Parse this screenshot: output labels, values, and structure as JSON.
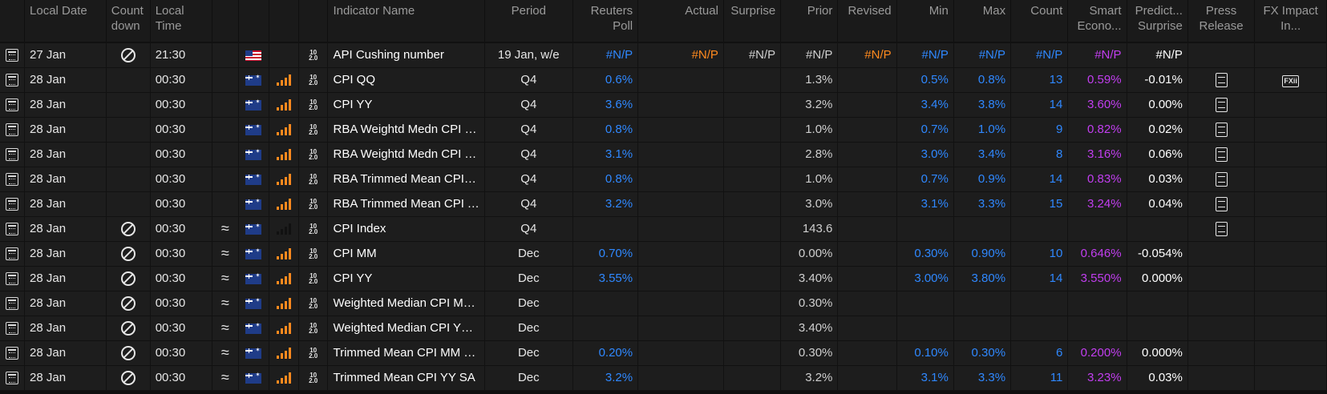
{
  "columns": [
    {
      "key": "icon",
      "label": "",
      "align": "c"
    },
    {
      "key": "date",
      "label": "Local Date",
      "align": "l"
    },
    {
      "key": "countdown",
      "label": "Count down",
      "align": "l"
    },
    {
      "key": "time",
      "label": "Local Time",
      "align": "l"
    },
    {
      "key": "approx",
      "label": "",
      "align": "c"
    },
    {
      "key": "flag",
      "label": "",
      "align": "c"
    },
    {
      "key": "importance",
      "label": "",
      "align": "c"
    },
    {
      "key": "type",
      "label": "",
      "align": "c"
    },
    {
      "key": "name",
      "label": "Indicator Name",
      "align": "l"
    },
    {
      "key": "period",
      "label": "Period",
      "align": "c"
    },
    {
      "key": "poll",
      "label": "Reuters Poll",
      "align": "r"
    },
    {
      "key": "actual",
      "label": "Actual",
      "align": "r"
    },
    {
      "key": "surprise",
      "label": "Surprise",
      "align": "r"
    },
    {
      "key": "prior",
      "label": "Prior",
      "align": "r"
    },
    {
      "key": "revised",
      "label": "Revised",
      "align": "r"
    },
    {
      "key": "min",
      "label": "Min",
      "align": "r"
    },
    {
      "key": "max",
      "label": "Max",
      "align": "r"
    },
    {
      "key": "count",
      "label": "Count",
      "align": "r"
    },
    {
      "key": "smart",
      "label": "Smart Econo...",
      "align": "r"
    },
    {
      "key": "predict",
      "label": "Predict... Surprise",
      "align": "r"
    },
    {
      "key": "press",
      "label": "Press Release",
      "align": "c"
    },
    {
      "key": "fx",
      "label": "FX Impact In...",
      "align": "c"
    }
  ],
  "icons": {
    "row": "calendar-icon",
    "countdown": "no-symbol-icon",
    "approx": "approx-icon",
    "importance": "importance-bars-icon",
    "type": "numeric-type-icon",
    "press": "document-icon",
    "fx": "fx-impact-icon"
  },
  "colors": {
    "blue": "#2f88ff",
    "orange": "#ff8a1e",
    "purple": "#c23ef0"
  },
  "rows": [
    {
      "date": "27 Jan",
      "no": true,
      "time": "21:30",
      "approx": false,
      "flag": "us",
      "bars": "none",
      "name": "API Cushing number",
      "period": "19 Jan, w/e",
      "poll": "#N/P",
      "actual": "#N/P",
      "surprise": "#N/P",
      "prior": "#N/P",
      "revised": "#N/P",
      "min": "#N/P",
      "max": "#N/P",
      "count": "#N/P",
      "smart": "#N/P",
      "predict": "#N/P",
      "press": false,
      "fx": false
    },
    {
      "date": "28 Jan",
      "no": false,
      "time": "00:30",
      "approx": false,
      "flag": "au",
      "bars": "full",
      "name": "CPI QQ",
      "period": "Q4",
      "poll": "0.6%",
      "actual": "",
      "surprise": "",
      "prior": "1.3%",
      "revised": "",
      "min": "0.5%",
      "max": "0.8%",
      "count": "13",
      "smart": "0.59%",
      "predict": "-0.01%",
      "press": true,
      "fx": true
    },
    {
      "date": "28 Jan",
      "no": false,
      "time": "00:30",
      "approx": false,
      "flag": "au",
      "bars": "full",
      "name": "CPI YY",
      "period": "Q4",
      "poll": "3.6%",
      "actual": "",
      "surprise": "",
      "prior": "3.2%",
      "revised": "",
      "min": "3.4%",
      "max": "3.8%",
      "count": "14",
      "smart": "3.60%",
      "predict": "0.00%",
      "press": true,
      "fx": false
    },
    {
      "date": "28 Jan",
      "no": false,
      "time": "00:30",
      "approx": false,
      "flag": "au",
      "bars": "full",
      "name": "RBA Weightd Medn CPI QQ",
      "period": "Q4",
      "poll": "0.8%",
      "actual": "",
      "surprise": "",
      "prior": "1.0%",
      "revised": "",
      "min": "0.7%",
      "max": "1.0%",
      "count": "9",
      "smart": "0.82%",
      "predict": "0.02%",
      "press": true,
      "fx": false
    },
    {
      "date": "28 Jan",
      "no": false,
      "time": "00:30",
      "approx": false,
      "flag": "au",
      "bars": "full",
      "name": "RBA Weightd Medn CPI YY",
      "period": "Q4",
      "poll": "3.1%",
      "actual": "",
      "surprise": "",
      "prior": "2.8%",
      "revised": "",
      "min": "3.0%",
      "max": "3.4%",
      "count": "8",
      "smart": "3.16%",
      "predict": "0.06%",
      "press": true,
      "fx": false
    },
    {
      "date": "28 Jan",
      "no": false,
      "time": "00:30",
      "approx": false,
      "flag": "au",
      "bars": "full",
      "name": "RBA Trimmed Mean CPI QQ",
      "period": "Q4",
      "poll": "0.8%",
      "actual": "",
      "surprise": "",
      "prior": "1.0%",
      "revised": "",
      "min": "0.7%",
      "max": "0.9%",
      "count": "14",
      "smart": "0.83%",
      "predict": "0.03%",
      "press": true,
      "fx": false
    },
    {
      "date": "28 Jan",
      "no": false,
      "time": "00:30",
      "approx": false,
      "flag": "au",
      "bars": "full",
      "name": "RBA Trimmed Mean CPI YY",
      "period": "Q4",
      "poll": "3.2%",
      "actual": "",
      "surprise": "",
      "prior": "3.0%",
      "revised": "",
      "min": "3.1%",
      "max": "3.3%",
      "count": "15",
      "smart": "3.24%",
      "predict": "0.04%",
      "press": true,
      "fx": false
    },
    {
      "date": "28 Jan",
      "no": true,
      "time": "00:30",
      "approx": true,
      "flag": "au",
      "bars": "low",
      "name": "CPI Index",
      "period": "Q4",
      "poll": "",
      "actual": "",
      "surprise": "",
      "prior": "143.6",
      "revised": "",
      "min": "",
      "max": "",
      "count": "",
      "smart": "",
      "predict": "",
      "press": true,
      "fx": false
    },
    {
      "date": "28 Jan",
      "no": true,
      "time": "00:30",
      "approx": true,
      "flag": "au",
      "bars": "full",
      "name": "CPI MM",
      "period": "Dec",
      "poll": "0.70%",
      "actual": "",
      "surprise": "",
      "prior": "0.00%",
      "revised": "",
      "min": "0.30%",
      "max": "0.90%",
      "count": "10",
      "smart": "0.646%",
      "predict": "-0.054%",
      "press": false,
      "fx": false
    },
    {
      "date": "28 Jan",
      "no": true,
      "time": "00:30",
      "approx": true,
      "flag": "au",
      "bars": "full",
      "name": "CPI YY",
      "period": "Dec",
      "poll": "3.55%",
      "actual": "",
      "surprise": "",
      "prior": "3.40%",
      "revised": "",
      "min": "3.00%",
      "max": "3.80%",
      "count": "14",
      "smart": "3.550%",
      "predict": "0.000%",
      "press": false,
      "fx": false
    },
    {
      "date": "28 Jan",
      "no": true,
      "time": "00:30",
      "approx": true,
      "flag": "au",
      "bars": "full",
      "name": "Weighted Median CPI MM SA",
      "period": "Dec",
      "poll": "",
      "actual": "",
      "surprise": "",
      "prior": "0.30%",
      "revised": "",
      "min": "",
      "max": "",
      "count": "",
      "smart": "",
      "predict": "",
      "press": false,
      "fx": false
    },
    {
      "date": "28 Jan",
      "no": true,
      "time": "00:30",
      "approx": true,
      "flag": "au",
      "bars": "full",
      "name": "Weighted Median CPI YY SA",
      "period": "Dec",
      "poll": "",
      "actual": "",
      "surprise": "",
      "prior": "3.40%",
      "revised": "",
      "min": "",
      "max": "",
      "count": "",
      "smart": "",
      "predict": "",
      "press": false,
      "fx": false
    },
    {
      "date": "28 Jan",
      "no": true,
      "time": "00:30",
      "approx": true,
      "flag": "au",
      "bars": "full",
      "name": "Trimmed Mean CPI MM SA",
      "period": "Dec",
      "poll": "0.20%",
      "actual": "",
      "surprise": "",
      "prior": "0.30%",
      "revised": "",
      "min": "0.10%",
      "max": "0.30%",
      "count": "6",
      "smart": "0.200%",
      "predict": "0.000%",
      "press": false,
      "fx": false
    },
    {
      "date": "28 Jan",
      "no": true,
      "time": "00:30",
      "approx": true,
      "flag": "au",
      "bars": "full",
      "name": "Trimmed Mean CPI YY SA",
      "period": "Dec",
      "poll": "3.2%",
      "actual": "",
      "surprise": "",
      "prior": "3.2%",
      "revised": "",
      "min": "3.1%",
      "max": "3.3%",
      "count": "11",
      "smart": "3.23%",
      "predict": "0.03%",
      "press": false,
      "fx": false
    }
  ]
}
